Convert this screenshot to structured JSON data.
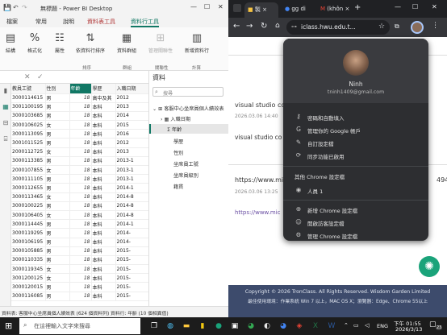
{
  "pbi": {
    "title": "無標題 - Power BI Desktop",
    "menu": [
      "檔案",
      "常用",
      "說明",
      "資料表工具",
      "資料行工具"
    ],
    "ribbon": {
      "items": [
        "結構",
        "格式化",
        "屬性",
        "依資料行排序",
        "資料群組",
        "管理關聯性",
        "新增資料行"
      ],
      "groups": [
        "排序",
        "群組",
        "關聯性",
        "計算"
      ]
    },
    "grid": {
      "headers": [
        "教員工號",
        "性別",
        "年齡",
        "學歷",
        "入職日期"
      ],
      "rows": [
        [
          "3000114615",
          "男",
          "18",
          "高中及其",
          "2012"
        ],
        [
          "3001100195",
          "男",
          "18",
          "本科",
          "2013"
        ],
        [
          "3000103685",
          "男",
          "18",
          "本科",
          "2014"
        ],
        [
          "3000106025",
          "女",
          "18",
          "本科",
          "2015"
        ],
        [
          "3000113095",
          "男",
          "18",
          "本科",
          "2016"
        ],
        [
          "3001011525",
          "男",
          "18",
          "本科",
          "2012"
        ],
        [
          "2000112725",
          "女",
          "18",
          "本科",
          "2013"
        ],
        [
          "3000113385",
          "男",
          "18",
          "本科",
          "2013-1"
        ],
        [
          "2000107855",
          "女",
          "18",
          "本科",
          "2013-1"
        ],
        [
          "3000111105",
          "男",
          "18",
          "本科",
          "2013-1"
        ],
        [
          "3000112655",
          "男",
          "18",
          "本科",
          "2014-1"
        ],
        [
          "3000113465",
          "女",
          "18",
          "本科",
          "2014-8"
        ],
        [
          "3000100225",
          "男",
          "18",
          "本科",
          "2014-8"
        ],
        [
          "3000106405",
          "女",
          "18",
          "本科",
          "2014-8"
        ],
        [
          "3000114445",
          "男",
          "18",
          "本科",
          "2014-1"
        ],
        [
          "3000119295",
          "男",
          "18",
          "本科",
          "2014-"
        ],
        [
          "3000106195",
          "男",
          "18",
          "本科",
          "2014-"
        ],
        [
          "3000105885",
          "男",
          "18",
          "本科",
          "2015-"
        ],
        [
          "3000110335",
          "男",
          "18",
          "本科",
          "2015-"
        ],
        [
          "3000119345",
          "女",
          "18",
          "本科",
          "2015-"
        ],
        [
          "3001200125",
          "女",
          "18",
          "本科",
          "2015-"
        ],
        [
          "3000120015",
          "男",
          "18",
          "本科",
          "2015-"
        ],
        [
          "3000116085",
          "男",
          "18",
          "本科",
          "2015-"
        ]
      ]
    },
    "fields": {
      "title": "資料",
      "search_placeholder": "搜尋",
      "table_name": "客服中心坐席員個人績效表",
      "items": [
        "入職日期",
        "年齡",
        "學歷",
        "性別",
        "坐席員工號",
        "坐席員級別",
        "籍貫"
      ]
    },
    "status": "資料表: 客服中心坐席員個人績效表 (624 個資料列) 資料行: 年齡 (10 個相異值)"
  },
  "chrome": {
    "tabs": [
      "製",
      "gg di",
      "(khôn"
    ],
    "url": "iclass.hwu.edu.t...",
    "posts": [
      {
        "title": "visual studio co",
        "date": "2026.03.06 14:40"
      },
      {
        "title": "visual studio co",
        "date": ""
      },
      {
        "title": "https://www.mic",
        "date": "2026.03.06 13:25"
      },
      {
        "title": "https://www.mic",
        "date": ""
      }
    ],
    "side_number": "494",
    "footer_line1": "Copyright © 2026 TronClass. All Rights Reserved. Wisdom Garden Limited",
    "footer_line2": "最佳使用環境：作業系統 Win 7 以上，MAC OS X；瀏覽器：Edge、Chrome 55以上"
  },
  "profile": {
    "name": "Ninh",
    "email": "tninh1409@gmail.com",
    "items": [
      "密碼和自動填入",
      "管理你的 Google 帳戶",
      "自訂設定檔",
      "同步功能已啟用"
    ],
    "other_title": "其他 Chrome 設定檔",
    "other_profile": "人員 1",
    "bottom_items": [
      "新增 Chrome 設定檔",
      "開啟訪客設定檔",
      "管理 Chrome 設定檔"
    ]
  },
  "taskbar": {
    "search_placeholder": "在這裡輸入文字來搜尋",
    "time": "下午 01:55",
    "date": "2026/3/13",
    "lang": "ENG",
    "notif_count": "23"
  },
  "colors": {
    "accent": "#117865",
    "chrome_dark": "#202124",
    "menu_bg": "#2d2e31",
    "footer": "#3d4b6c"
  }
}
